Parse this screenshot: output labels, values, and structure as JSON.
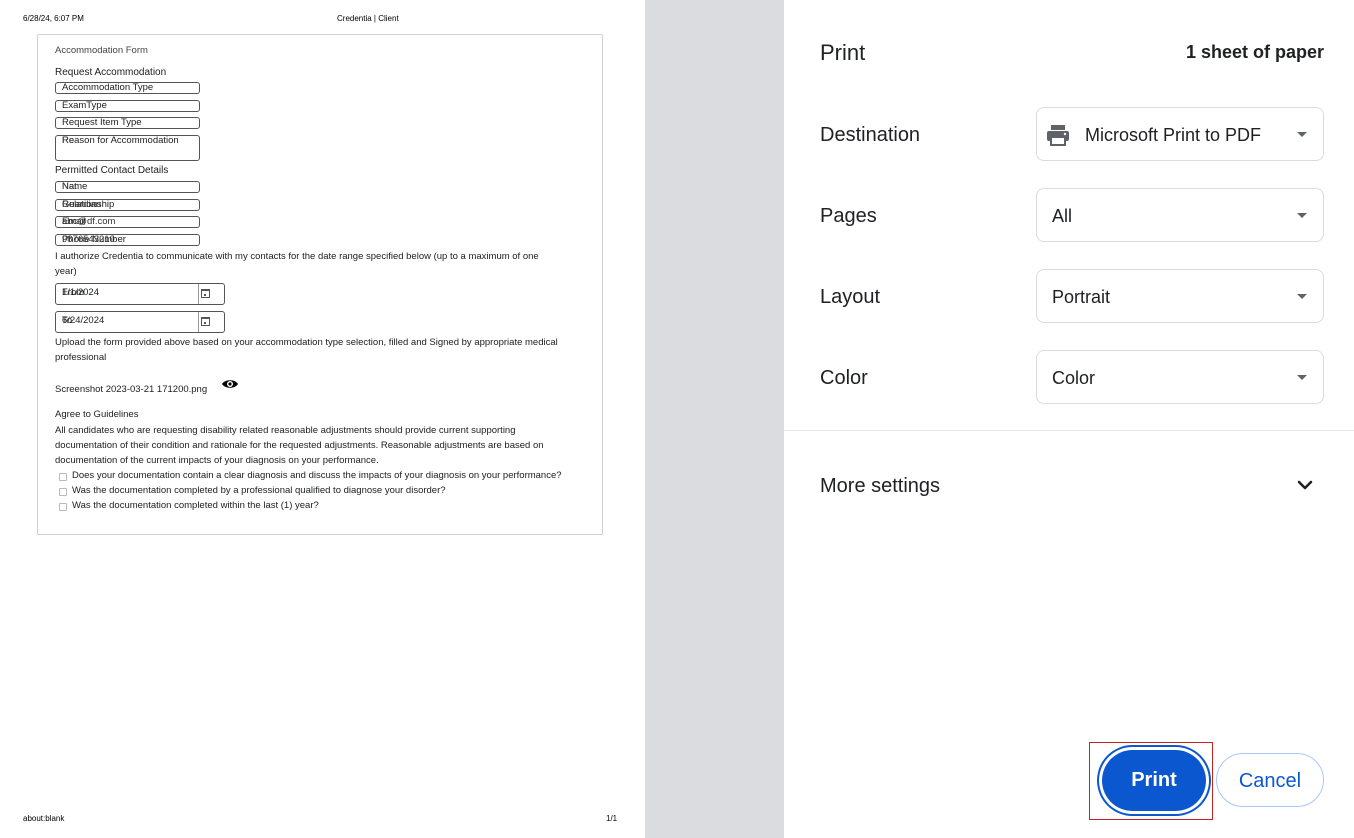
{
  "preview": {
    "header_left": "6/28/24, 6:07 PM",
    "header_center": "Credentia | Client",
    "footer_left": "about:blank",
    "footer_right": "1/1",
    "form": {
      "title": "Accommodation Form",
      "request_section": "Request Accommodation",
      "fields": [
        "Accommodation Type",
        "ExamType",
        "Request Item Type",
        "Reason for Accommodation"
      ],
      "reason_overlap": "Re",
      "contacts_section": "Permitted Contact Details",
      "contact_fields": [
        {
          "placeholder": "Name",
          "value": "Nat"
        },
        {
          "placeholder": "Relationship",
          "value": "Guardian"
        },
        {
          "placeholder": "Email",
          "value": "abc@df.com"
        },
        {
          "placeholder": "Phone Number",
          "value": "9876543210"
        }
      ],
      "authorize_text_1": "I authorize Credentia to communicate with my contacts for the date range specified below (up to a maximum of one",
      "authorize_text_2": "year)",
      "from": {
        "placeholder": "From",
        "value": "1/1/2024"
      },
      "to": {
        "placeholder": "To",
        "value": "6/24/2024"
      },
      "upload_text_1": "Upload the form provided above based on your accommodation type selection, filled and Signed by appropriate medical",
      "upload_text_2": "professional",
      "file_name": "Screenshot 2023-03-21 171200.png",
      "guidelines_title": "Agree to Guidelines",
      "guidelines_1": "All candidates who are requesting disability related reasonable adjustments should provide current supporting",
      "guidelines_2": "documentation of their condition and rationale for the requested adjustments. Reasonable adjustments are based on",
      "guidelines_3": "documentation of the current impacts of your diagnosis on your performance.",
      "checks": [
        "Does your documentation contain a clear diagnosis and discuss the impacts of your diagnosis on your performance?",
        "Was the documentation completed by a professional qualified to diagnose your disorder?",
        "Was the documentation completed within the last (1) year?"
      ]
    }
  },
  "panel": {
    "title": "Print",
    "sheets": "1 sheet of paper",
    "destination_label": "Destination",
    "destination_value": "Microsoft Print to PDF",
    "pages_label": "Pages",
    "pages_value": "All",
    "layout_label": "Layout",
    "layout_value": "Portrait",
    "color_label": "Color",
    "color_value": "Color",
    "more_settings": "More settings",
    "print_button": "Print",
    "cancel_button": "Cancel"
  }
}
